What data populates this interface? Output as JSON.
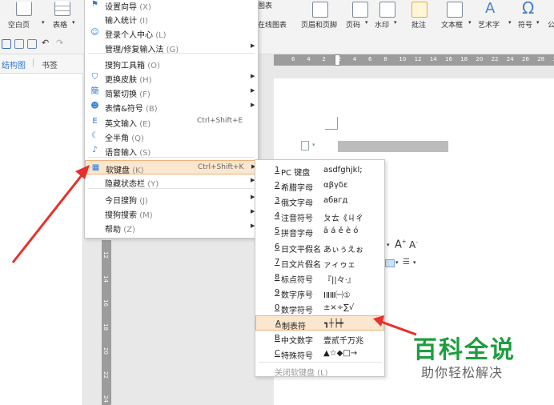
{
  "ribbon": {
    "blank_page": "空白页",
    "table": "表格",
    "chart": "图表",
    "online_chart": "在线图表",
    "header_footer": "页眉和页脚",
    "page_number": "页码",
    "watermark": "水印",
    "annotation": "批注",
    "text_box": "文本框",
    "word_art": "艺术字",
    "symbol": "符号",
    "formula_partial": "公"
  },
  "nav": {
    "tab_outline": "结构图",
    "tab_bookmark": "书签"
  },
  "ruler": {
    "top_ticks": [
      "6",
      "4",
      "2",
      "2",
      "4",
      "6",
      "8",
      "10",
      "12",
      "14",
      "16",
      "18",
      "20",
      "22",
      "24",
      "26",
      "28",
      "3"
    ],
    "left_ticks": [
      "12",
      "14",
      "16",
      "18",
      "20",
      "22",
      "24"
    ]
  },
  "menu": {
    "items": [
      {
        "icon": "wizard-icon",
        "label": "设置向导",
        "key": "(X)",
        "shortcut": "",
        "arrow": false
      },
      {
        "icon": "",
        "label": "输入统计",
        "key": "(I)",
        "shortcut": "",
        "arrow": false
      },
      {
        "icon": "user-icon",
        "label": "登录个人中心",
        "key": "(L)",
        "shortcut": "",
        "arrow": false
      },
      {
        "icon": "",
        "label": "管理/修复输入法",
        "key": "(G)",
        "shortcut": "",
        "arrow": true
      },
      {
        "icon": "",
        "label": "搜狗工具箱",
        "key": "(O)",
        "shortcut": "",
        "arrow": false
      },
      {
        "icon": "shirt-icon",
        "label": "更换皮肤",
        "key": "(H)",
        "shortcut": "",
        "arrow": true
      },
      {
        "icon": "simplified-traditional-icon",
        "label": "简繁切换",
        "key": "(F)",
        "shortcut": "",
        "arrow": true
      },
      {
        "icon": "emoji-icon",
        "label": "表情&符号",
        "key": "(B)",
        "shortcut": "",
        "arrow": true
      },
      {
        "icon": "english-icon",
        "label": "英文输入",
        "key": "(E)",
        "shortcut": "Ctrl+Shift+E",
        "arrow": false
      },
      {
        "icon": "moon-icon",
        "label": "全半角",
        "key": "(Q)",
        "shortcut": "",
        "arrow": false
      },
      {
        "icon": "microphone-icon",
        "label": "语音输入",
        "key": "(S)",
        "shortcut": "",
        "arrow": false
      },
      {
        "icon": "keyboard-icon",
        "label": "软键盘",
        "key": "(K)",
        "shortcut": "Ctrl+Shift+K",
        "arrow": true
      },
      {
        "icon": "",
        "label": "隐藏状态栏",
        "key": "(Y)",
        "shortcut": "",
        "arrow": true
      },
      {
        "icon": "",
        "label": "今日搜狗",
        "key": "(J)",
        "shortcut": "",
        "arrow": true
      },
      {
        "icon": "",
        "label": "搜狗搜索",
        "key": "(M)",
        "shortcut": "",
        "arrow": true
      },
      {
        "icon": "",
        "label": "帮助",
        "key": "(Z)",
        "shortcut": "",
        "arrow": true
      }
    ]
  },
  "submenu": {
    "items": [
      {
        "num": "1",
        "label": "PC 键盘",
        "preview": "asdfghjkl;"
      },
      {
        "num": "2",
        "label": "希腊字母",
        "preview": "αβγδε"
      },
      {
        "num": "3",
        "label": "俄文字母",
        "preview": "абвгд"
      },
      {
        "num": "4",
        "label": "注音符号",
        "preview": "ㄆㄊ《ㄐㄔ"
      },
      {
        "num": "5",
        "label": "拼音字母",
        "preview": "ā á ě è ó"
      },
      {
        "num": "6",
        "label": "日文平假名",
        "preview": "あぃぅえぉ"
      },
      {
        "num": "7",
        "label": "日文片假名",
        "preview": "ァィゥェ"
      },
      {
        "num": "8",
        "label": "标点符号",
        "preview": "『||々·』"
      },
      {
        "num": "9",
        "label": "数字序号",
        "preview": "ⅠⅡⅢ㈠①"
      },
      {
        "num": "0",
        "label": "数学符号",
        "preview": "±×÷∑√"
      },
      {
        "num": "A",
        "label": "制表符",
        "preview": "┓┼┝┿"
      },
      {
        "num": "B",
        "label": "中文数字",
        "preview": "壹贰千万兆"
      },
      {
        "num": "C",
        "label": "特殊符号",
        "preview": "▲☆◆□→"
      }
    ],
    "close_label": "关闭软键盘 (L)"
  },
  "watermark": {
    "title": "百科全说",
    "subtitle": "助你轻松解决"
  },
  "colors": {
    "highlight": "#fbe6cf",
    "arrow_red": "#e8302a",
    "watermark_green": "#1e9e3e"
  }
}
